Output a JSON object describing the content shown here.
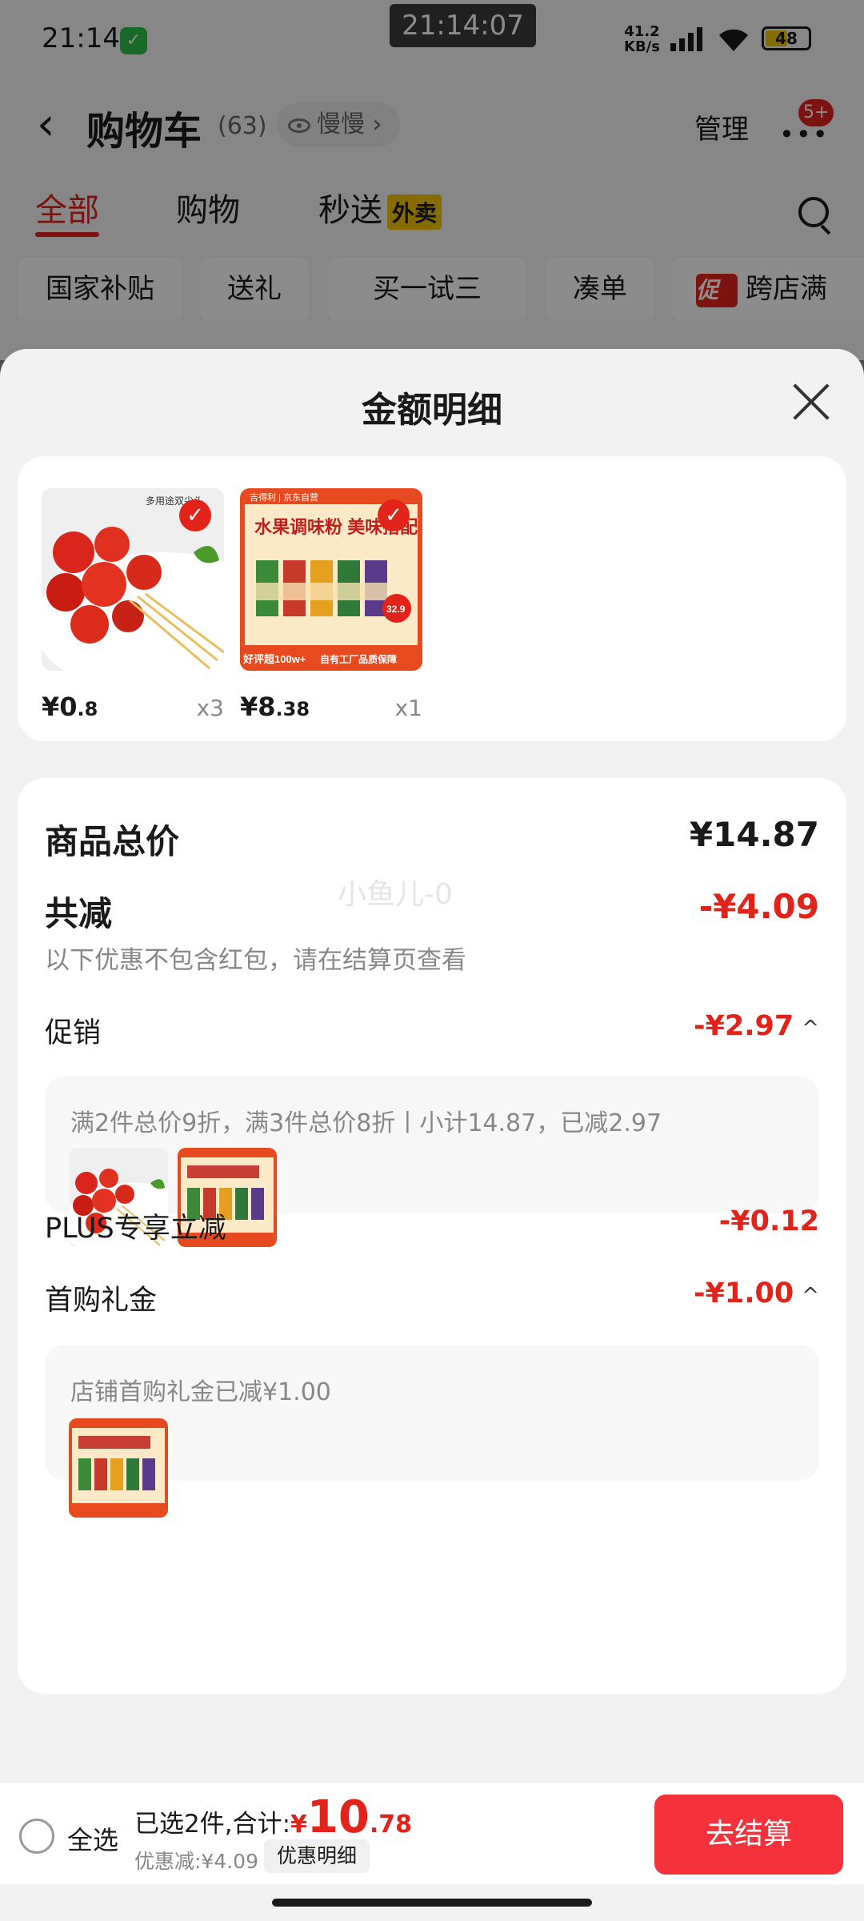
{
  "status_bar": {
    "time": "21:14",
    "clock": "21:14:07",
    "net_speed_top": "41.2",
    "net_speed_bottom": "KB/s",
    "battery": "48",
    "battery_level": 0.48
  },
  "cart": {
    "title": "购物车",
    "count": "(63)",
    "visitor": "慢慢",
    "manage": "管理",
    "badge": "5+",
    "tabs": [
      "全部",
      "购物",
      "秒送"
    ],
    "waimai_tag": "外卖",
    "filters": [
      "国家补贴",
      "送礼",
      "买一试三",
      "凑单",
      "跨店满"
    ],
    "promo_tag": "促"
  },
  "sheet": {
    "title": "金额明细",
    "products": [
      {
        "price_main": "¥0",
        "price_small": ".8",
        "qty": "x3",
        "image_text": "多用途双尖头"
      },
      {
        "price_main": "¥8",
        "price_small": ".38",
        "qty": "x1",
        "image_text": "水果调味粉 美味搭配",
        "image_badge": "好评超100w+",
        "image_footer": "自有工厂品质保障",
        "image_brand": "吉得利 | 京东自营",
        "image_price": "32.9"
      }
    ],
    "total_label": "商品总价",
    "total_value": "¥14.87",
    "reduce_label": "共减",
    "reduce_value": "-¥4.09",
    "reduce_note": "以下优惠不包含红包，请在结算页查看",
    "watermark": "小鱼儿-0",
    "promo_label": "促销",
    "promo_value": "-¥2.97",
    "promo_detail": "满2件总价9折，满3件总价8折丨小计14.87，已减2.97",
    "plus_label": "PLUS专享立减",
    "plus_value": "-¥0.12",
    "first_label": "首购礼金",
    "first_value": "-¥1.00",
    "first_detail": "店铺首购礼金已减¥1.00"
  },
  "bottom": {
    "select_all": "全选",
    "selected_text": "已选2件,合计:",
    "yen": "¥",
    "total_int": "10",
    "total_dec": ".78",
    "discount_text": "优惠减:¥4.09",
    "discount_btn": "优惠明细",
    "checkout": "去结算"
  },
  "colors": {
    "accent": "#e2231a",
    "checkout": "#f5313c",
    "waimai": "#f5c400"
  }
}
